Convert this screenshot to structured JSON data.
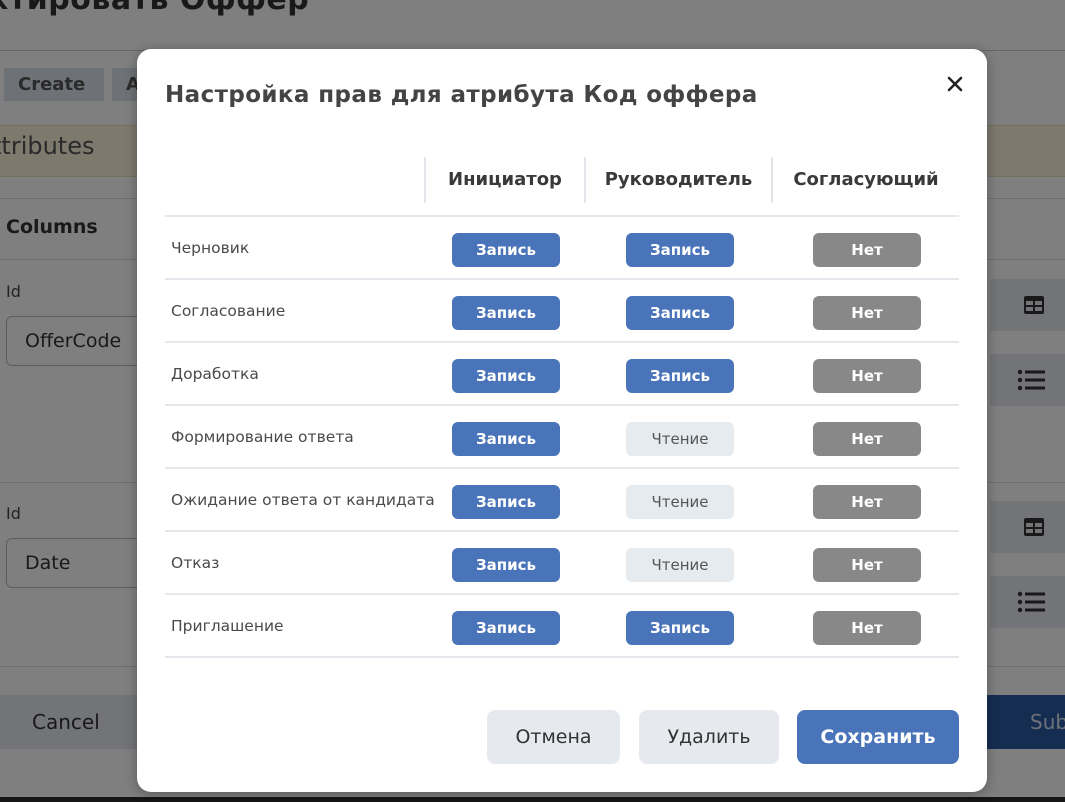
{
  "background": {
    "page_title": "ктировать Оффер",
    "tabs": [
      "Create",
      "A"
    ],
    "attributes_title": "ttributes",
    "columns_title": "Columns",
    "rows": [
      {
        "id_label": "Id",
        "id_value": "OfferCode"
      },
      {
        "id_label": "Id",
        "id_value": "Date"
      }
    ],
    "cancel_label": "Cancel",
    "submit_label": "Sub"
  },
  "modal": {
    "title": "Настройка прав для атрибута Код оффера",
    "close_symbol": "✕",
    "columns": [
      "Инициатор",
      "Руководитель",
      "Согласующий"
    ],
    "rows": [
      {
        "stage": "Черновик",
        "perms": [
          "Запись",
          "Запись",
          "Нет"
        ]
      },
      {
        "stage": "Согласование",
        "perms": [
          "Запись",
          "Запись",
          "Нет"
        ]
      },
      {
        "stage": "Доработка",
        "perms": [
          "Запись",
          "Запись",
          "Нет"
        ]
      },
      {
        "stage": "Формирование ответа",
        "perms": [
          "Запись",
          "Чтение",
          "Нет"
        ]
      },
      {
        "stage": "Ожидание ответа от кандидата",
        "perms": [
          "Запись",
          "Чтение",
          "Нет"
        ]
      },
      {
        "stage": "Отказ",
        "perms": [
          "Запись",
          "Чтение",
          "Нет"
        ]
      },
      {
        "stage": "Приглашение",
        "perms": [
          "Запись",
          "Запись",
          "Нет"
        ]
      }
    ],
    "buttons": {
      "cancel": "Отмена",
      "delete": "Удалить",
      "save": "Сохранить"
    }
  },
  "colors": {
    "write": "#4a74b9",
    "read": "#e6ebef",
    "none": "#888888",
    "primary": "#4a74b9"
  }
}
